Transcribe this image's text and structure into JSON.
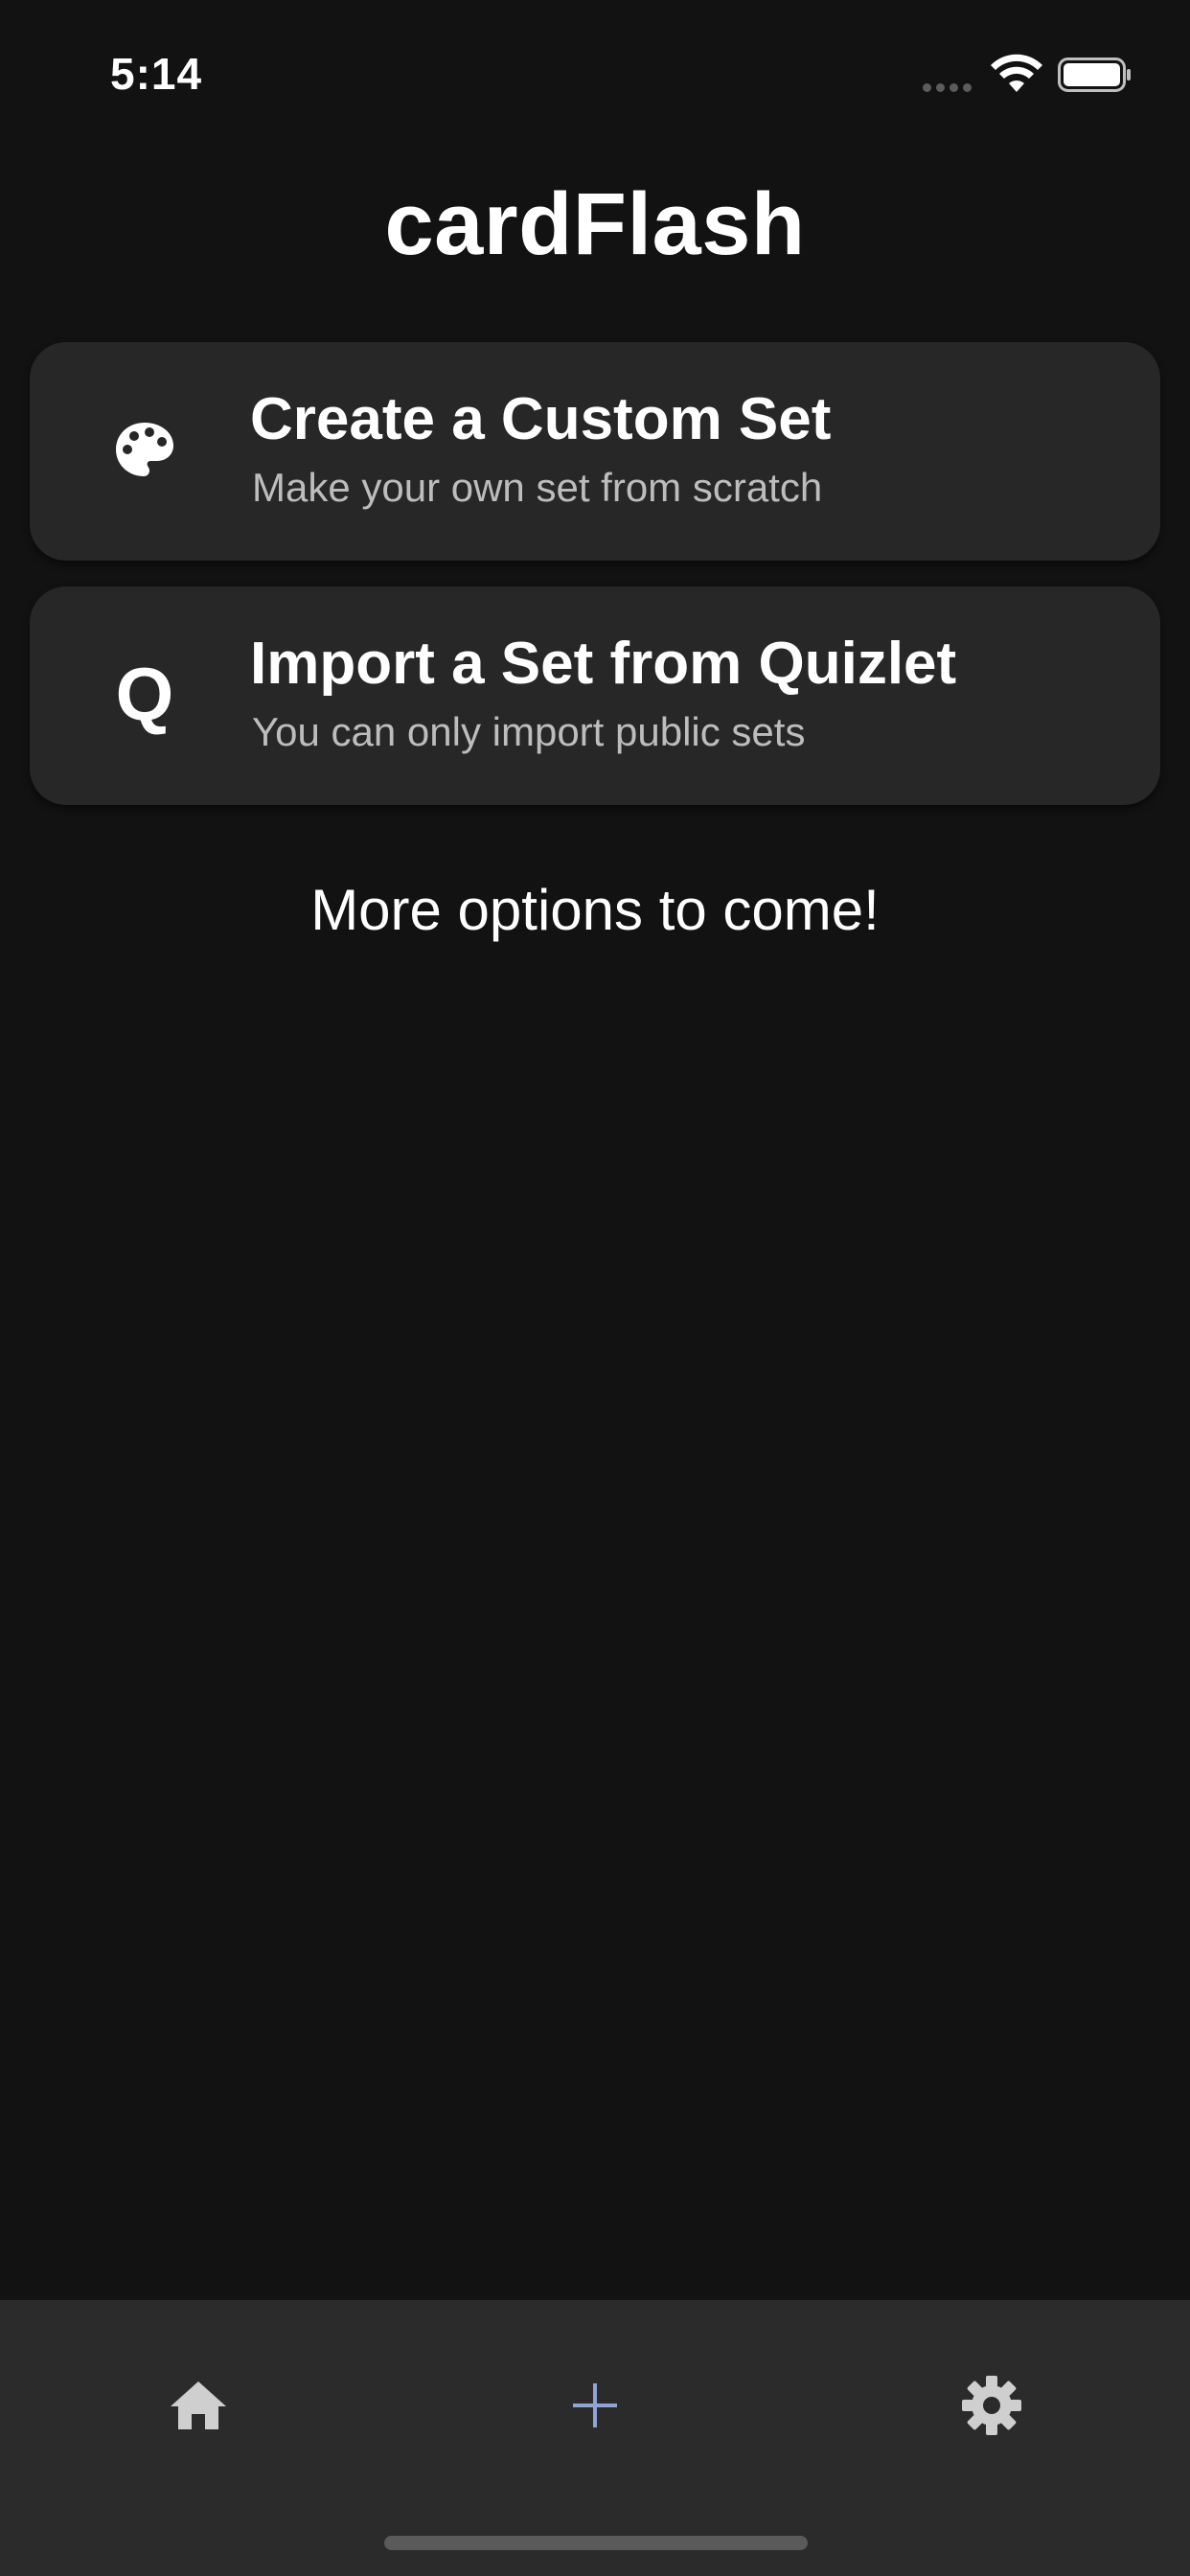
{
  "status_bar": {
    "time": "5:14"
  },
  "app": {
    "title": "cardFlash"
  },
  "options": [
    {
      "icon": "palette-icon",
      "title": "Create a Custom Set",
      "subtitle": "Make your own set from scratch"
    },
    {
      "icon": "quizlet-q-icon",
      "icon_text": "Q",
      "title": "Import a Set from Quizlet",
      "subtitle": "You can only import public sets"
    }
  ],
  "more_options_text": "More options to come!",
  "bottom_nav": {
    "items": [
      {
        "icon": "home-icon"
      },
      {
        "icon": "plus-icon",
        "active": true
      },
      {
        "icon": "gear-icon"
      }
    ]
  },
  "colors": {
    "background": "#121212",
    "card": "#272727",
    "nav_bar": "#2b2b2b",
    "subtitle_text": "#bdbdbd",
    "active_tab": "#8fa3d6",
    "inactive_tab": "#cfcfcf"
  }
}
